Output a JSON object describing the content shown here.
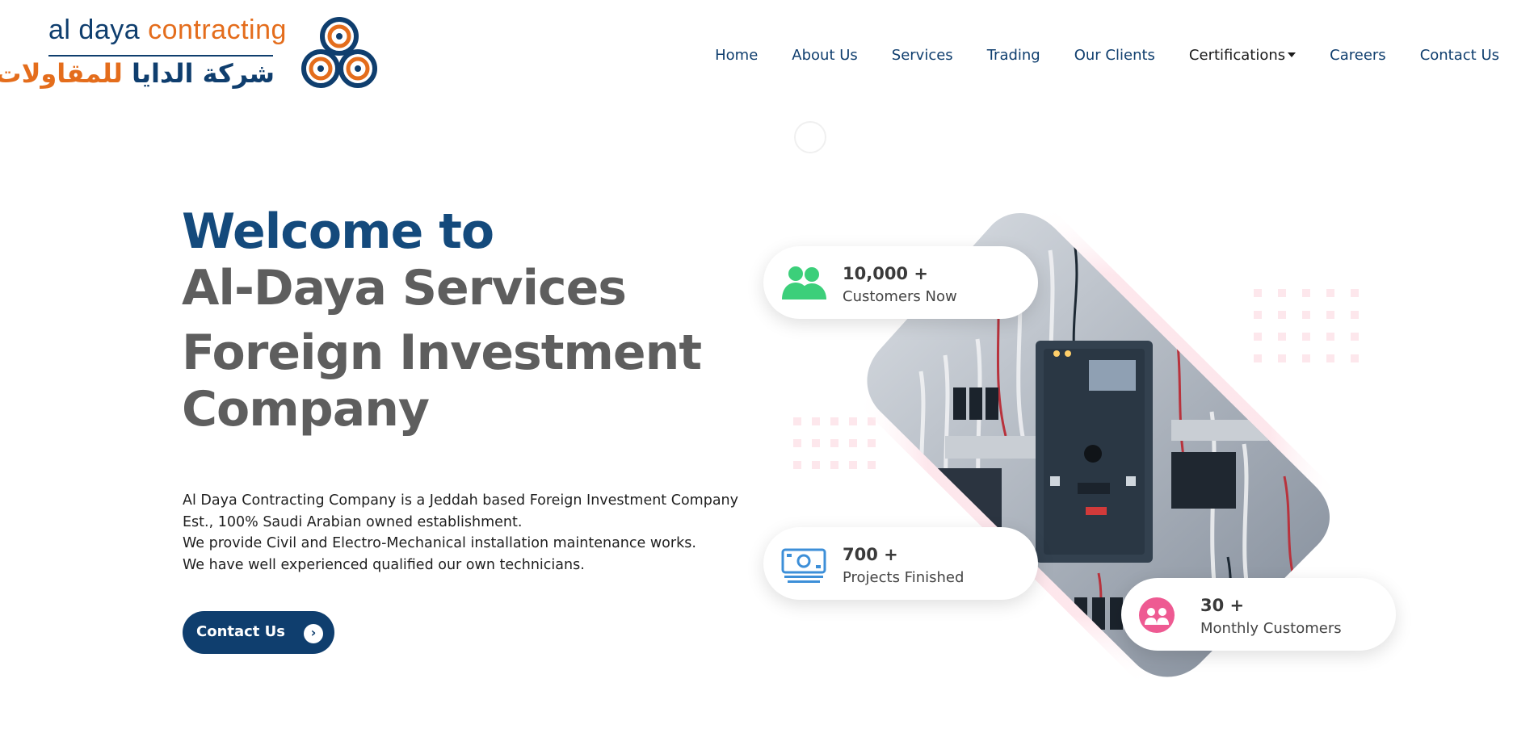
{
  "logo": {
    "en_word1": "al daya",
    "en_word2": "contracting",
    "ar_word1": "شركة الدايا",
    "ar_word2": "للمقاولات"
  },
  "nav": {
    "items": [
      "Home",
      "About Us",
      "Services",
      "Trading",
      "Our Clients",
      "Certifications",
      "Careers",
      "Contact Us"
    ]
  },
  "hero": {
    "line1": "Welcome to",
    "line2": "Al-Daya Services",
    "line3": "Foreign Investment",
    "line4": "Company",
    "desc": [
      "Al Daya Contracting Company is a Jeddah based Foreign Investment Company",
      "Est., 100% Saudi Arabian owned establishment.",
      "We provide Civil and Electro-Mechanical installation maintenance works.",
      "We have well experienced qualified our own technicians."
    ],
    "cta_label": "Contact Us"
  },
  "stats": [
    {
      "value": "10,000 +",
      "label": "Customers Now",
      "icon": "users-icon",
      "color": "#3ccf7a"
    },
    {
      "value": "700 +",
      "label": "Projects Finished",
      "icon": "banknote-icon",
      "color": "#3d8fd8"
    },
    {
      "value": "30 +",
      "label": "Monthly Customers",
      "icon": "user-group-icon",
      "color": "#ee5a92"
    }
  ],
  "colors": {
    "brand_blue": "#0f3e6e",
    "brand_orange": "#e46d1c",
    "heading_grey": "#5e5e5e"
  }
}
